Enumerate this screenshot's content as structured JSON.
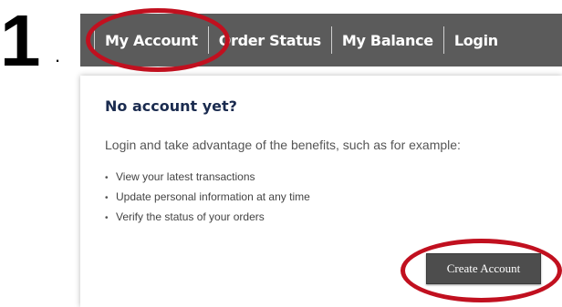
{
  "step": {
    "number": "1",
    "dot": "."
  },
  "nav": {
    "items": [
      {
        "label": "My Account"
      },
      {
        "label": "Order Status"
      },
      {
        "label": "My Balance"
      },
      {
        "label": "Login"
      }
    ]
  },
  "panel": {
    "heading": "No account yet?",
    "intro": "Login and take advantage of the benefits, such as for example:",
    "benefits": [
      "View your latest transactions",
      "Update personal information at any time",
      "Verify the status of your orders"
    ],
    "create_button": "Create Account"
  },
  "colors": {
    "nav_bg": "#5b5b5b",
    "heading": "#1a2b4f",
    "button_bg": "#4d4d4d",
    "annotation": "#c1101f"
  }
}
